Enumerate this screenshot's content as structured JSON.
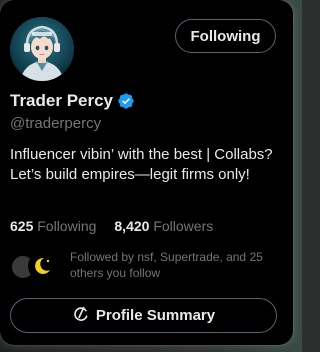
{
  "profile": {
    "display_name": "Trader Percy",
    "handle": "@traderpercy",
    "verified": true,
    "avatar_icon": "anime-character-avatar",
    "bio": "Influencer vibin’ with the best | Collabs? Let’s build empires—legit firms only!"
  },
  "actions": {
    "follow_label": "Following",
    "summary_label": "Profile Summary",
    "summary_icon": "refresh-circle-icon"
  },
  "stats": {
    "following_count": "625",
    "following_label": "Following",
    "followers_count": "8,420",
    "followers_label": "Followers"
  },
  "followed_by": {
    "text": "Followed by nsf, Supertrade, and 25 others you follow"
  },
  "colors": {
    "background": "#000000",
    "text_primary": "#e7e9ea",
    "text_secondary": "#71767b",
    "verified_blue": "#1d9bf0",
    "border": "#536471"
  }
}
